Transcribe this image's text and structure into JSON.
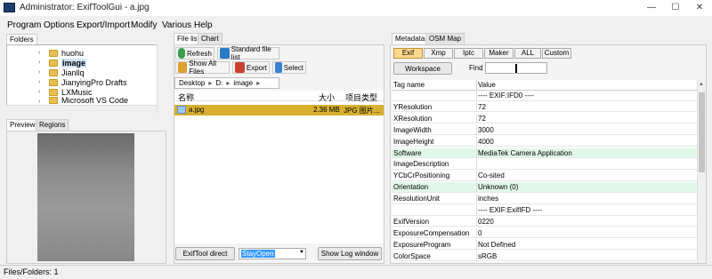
{
  "window": {
    "title": "Administrator: ExifToolGui - a.jpg",
    "minimize": "—",
    "maximize": "☐",
    "close": "✕"
  },
  "menu": [
    "Program",
    "Options",
    "Export/Import",
    "Modify",
    "Various",
    "Help"
  ],
  "left": {
    "tab_folders": "Folders",
    "tree": [
      "huohu",
      "image",
      "Jianllq",
      "JianyingPro Drafts",
      "LXMusic",
      "Microsoft VS Code"
    ],
    "selected": "image",
    "tab_preview": "Preview",
    "tab_regions": "Regions"
  },
  "middle": {
    "tab_filelist": "File list",
    "tab_chart": "Chart",
    "refresh": "Refresh",
    "standard": "Standard file list",
    "show_all": "Show All Files",
    "export": "Export",
    "select": "Select",
    "breadcrumb": [
      "Desktop",
      "D:",
      "image"
    ],
    "col_name": "名称",
    "col_size": "大小",
    "col_type": "项目类型",
    "file": {
      "name": "a.jpg",
      "size": "2.36 MB",
      "type": "JPG 图片..."
    },
    "exiftool_direct": "ExifTool direct",
    "stayopen": "StayOpen",
    "show_log": "Show Log window"
  },
  "right": {
    "tab_metadata": "Metadata",
    "tab_osm": "OSM Map",
    "filters": [
      "Exif",
      "Xmp",
      "Iptc",
      "Maker",
      "ALL",
      "Custom"
    ],
    "active_filter": "Exif",
    "workspace": "Workspace",
    "find_label": "Find",
    "col_tag": "Tag name",
    "col_value": "Value",
    "rows": [
      {
        "tag": "",
        "value": "---- EXIF:IFD0 ----",
        "section": true
      },
      {
        "tag": "YResolution",
        "value": "72"
      },
      {
        "tag": "XResolution",
        "value": "72"
      },
      {
        "tag": "ImageWidth",
        "value": "3000"
      },
      {
        "tag": "ImageHeight",
        "value": "4000"
      },
      {
        "tag": "Software",
        "value": "MediaTek Camera Application",
        "hl": true
      },
      {
        "tag": "ImageDescription",
        "value": ""
      },
      {
        "tag": "YCbCrPositioning",
        "value": "Co-sited"
      },
      {
        "tag": "Orientation",
        "value": "Unknown (0)",
        "hl": true
      },
      {
        "tag": "ResolutionUnit",
        "value": "inches"
      },
      {
        "tag": "",
        "value": "---- EXIF:ExifIFD ----",
        "section": true
      },
      {
        "tag": "ExifVersion",
        "value": "0220"
      },
      {
        "tag": "ExposureCompensation",
        "value": "0"
      },
      {
        "tag": "ExposureProgram",
        "value": "Not Defined"
      },
      {
        "tag": "ColorSpace",
        "value": "sRGB"
      }
    ]
  },
  "status": {
    "text": "Files/Folders: 1"
  },
  "colors": {
    "accent": "#d8b030",
    "selection": "#3399ff",
    "highlight": "#e0f8e8"
  }
}
